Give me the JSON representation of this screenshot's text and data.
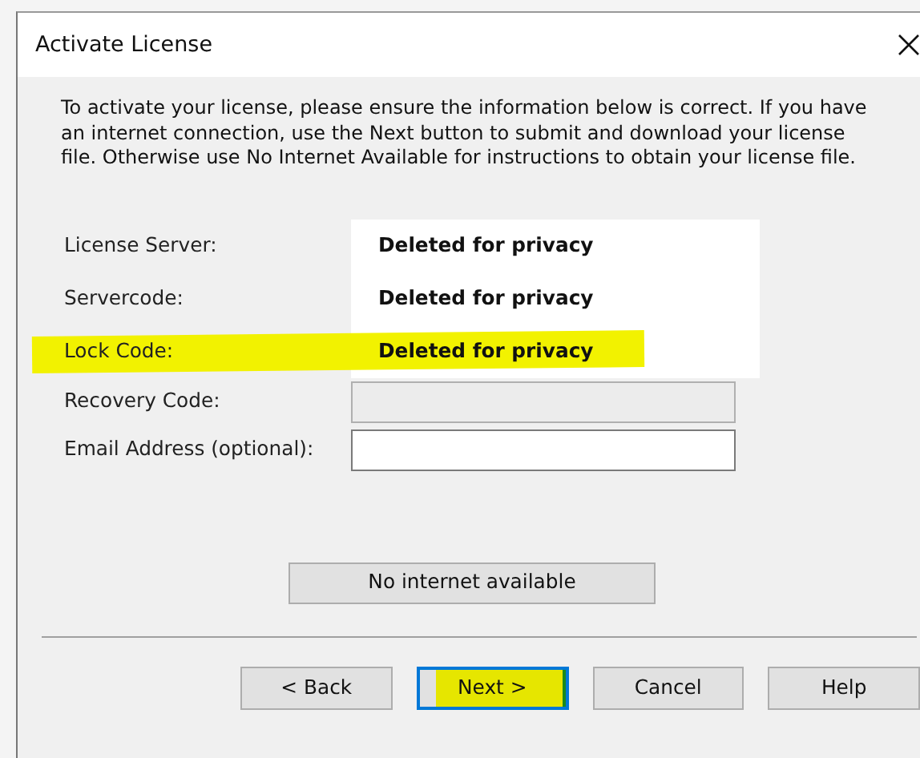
{
  "window": {
    "title": "Activate License"
  },
  "intro": "To activate your license, please ensure the information below is correct. If you have an internet connection, use the Next button to submit and download your license file. Otherwise use No Internet Available for instructions to obtain your license file.",
  "fields": [
    {
      "label": "License Server:",
      "kind": "redacted",
      "value": "Deleted for privacy",
      "highlighted": false
    },
    {
      "label": "Servercode:",
      "kind": "redacted",
      "value": "Deleted for privacy",
      "highlighted": false
    },
    {
      "label": "Lock Code:",
      "kind": "redacted",
      "value": "Deleted for privacy",
      "highlighted": true
    },
    {
      "label": "Recovery Code:",
      "kind": "input",
      "disabled": true
    },
    {
      "label": "Email Address (optional):",
      "kind": "input",
      "disabled": false
    }
  ],
  "no_internet_button": "No internet available",
  "buttons": [
    {
      "label": "< Back",
      "default": false,
      "highlighted": false
    },
    {
      "label": "Next >",
      "default": true,
      "highlighted": true
    },
    {
      "label": "Cancel",
      "default": false,
      "highlighted": false
    },
    {
      "label": "Help",
      "default": false,
      "highlighted": false
    }
  ]
}
